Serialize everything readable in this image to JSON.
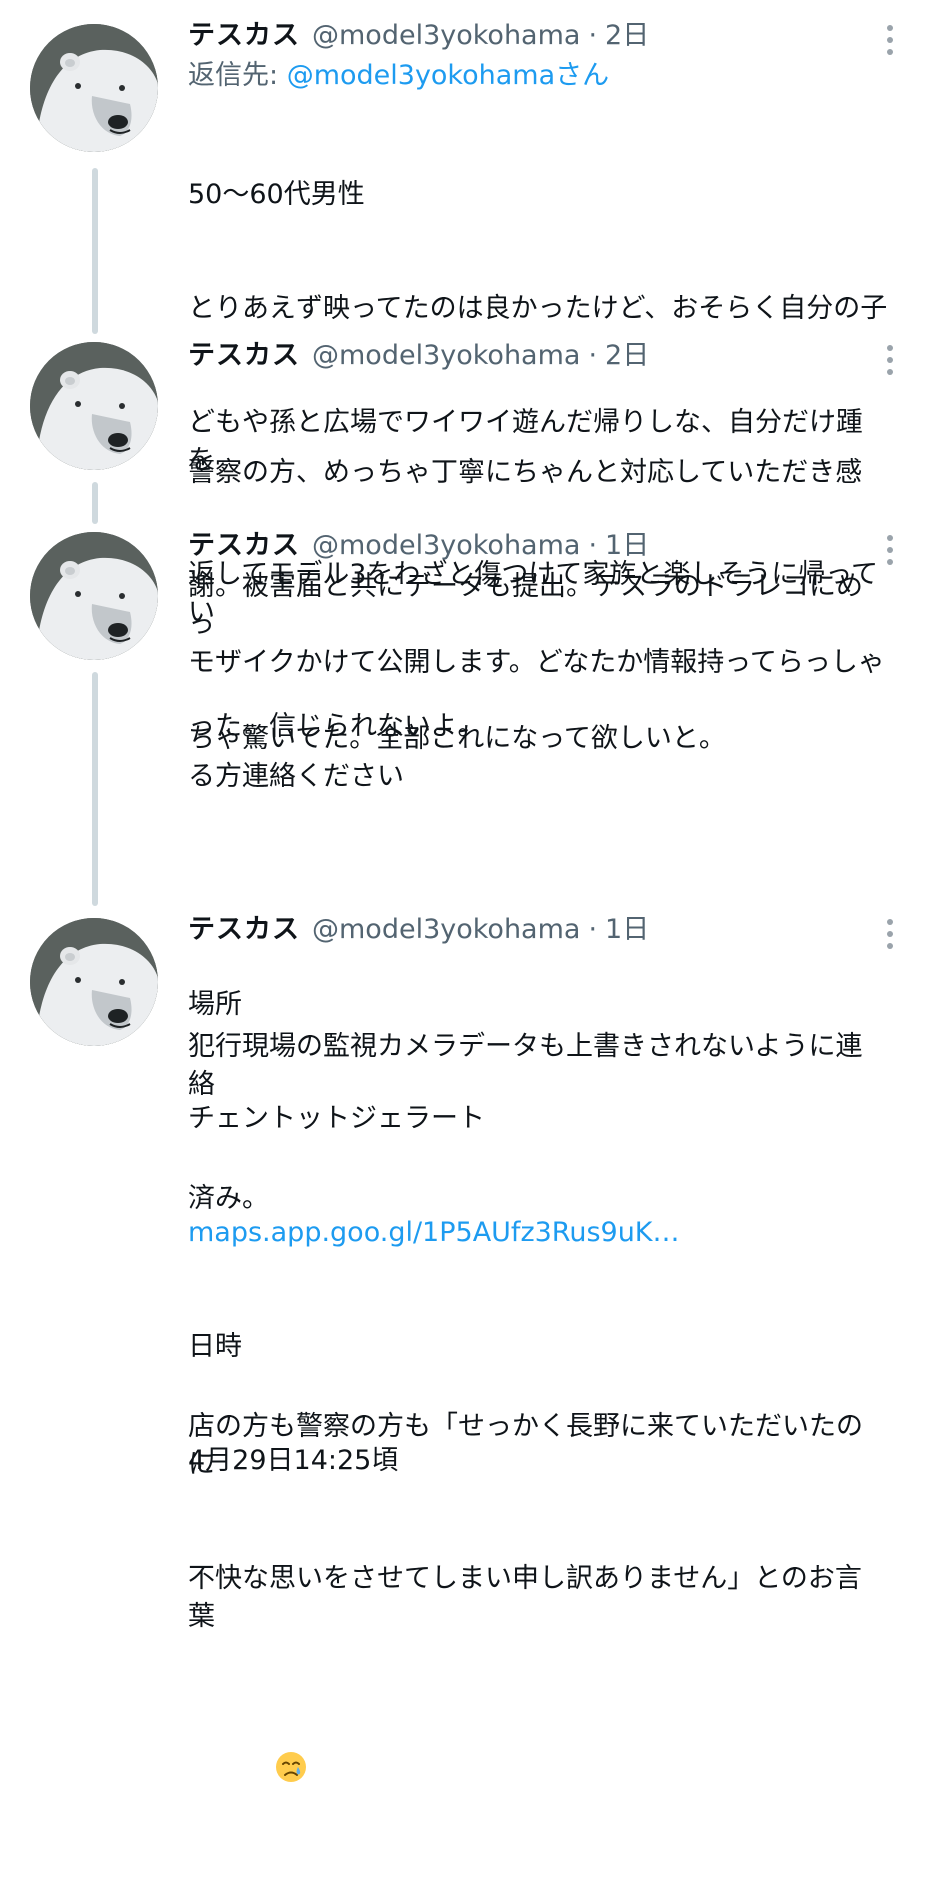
{
  "tweets": [
    {
      "name": "テスカス",
      "handle": "@model3yokohama",
      "sep": "·",
      "time": "2日",
      "reply_prefix": "返信先: ",
      "reply_handle": "@model3yokohamaさん",
      "lines": [
        "50〜60代男性",
        "とりあえず映ってたのは良かったけど、おそらく自分の子",
        "どもや孫と広場でワイワイ遊んだ帰りしな、自分だけ踵を",
        "返してモデル3をわざと傷つけて家族と楽しそうに帰ってい",
        "った。信じられないよ。"
      ]
    },
    {
      "name": "テスカス",
      "handle": "@model3yokohama",
      "sep": "·",
      "time": "2日",
      "lines": [
        "警察の方、めっちゃ丁寧にちゃんと対応していただき感",
        "謝。被害届と共にデータも提出。テスラのドラレコにめっ",
        "ちゃ驚いてた。全部これになって欲しいと。"
      ]
    },
    {
      "name": "テスカス",
      "handle": "@model3yokohama",
      "sep": "·",
      "time": "1日",
      "lines": [
        "モザイクかけて公開します。どなたか情報持ってらっしゃ",
        "る方連絡ください",
        "",
        "場所",
        "チェントットジェラート"
      ],
      "link": "maps.app.goo.gl/1P5AUfz3Rus9uK…",
      "lines_after": [
        "日時",
        "4月29日14:25頃"
      ]
    },
    {
      "name": "テスカス",
      "handle": "@model3yokohama",
      "sep": "·",
      "time": "1日",
      "lines": [
        "犯行現場の監視カメラデータも上書きされないように連絡",
        "済み。",
        "",
        "店の方も警察の方も「せっかく長野に来ていただいたのに",
        "不快な思いをさせてしまい申し訳ありません」とのお言葉"
      ],
      "emoji": "crying-face"
    }
  ]
}
